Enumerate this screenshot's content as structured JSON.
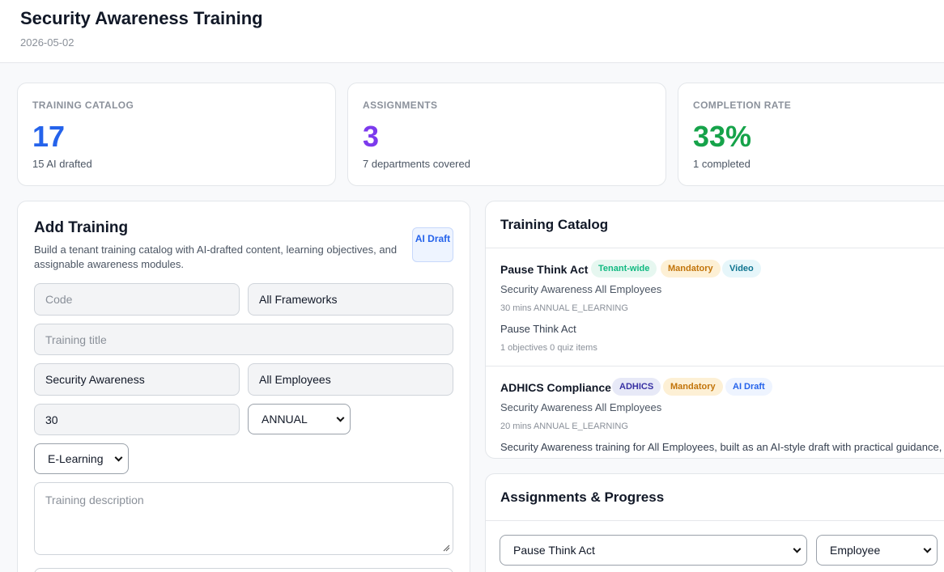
{
  "header": {
    "title": "Security Awareness Training",
    "date": "2026-05-02"
  },
  "stats": [
    {
      "label": "TRAINING CATALOG",
      "value": "17",
      "sub": "15 AI drafted",
      "color": "#2563eb"
    },
    {
      "label": "ASSIGNMENTS",
      "value": "3",
      "sub": "7 departments covered",
      "color": "#7c3aed"
    },
    {
      "label": "COMPLETION RATE",
      "value": "33%",
      "sub": "1 completed",
      "color": "#16a34a"
    }
  ],
  "add_training": {
    "title": "Add Training",
    "description": "Build a tenant training catalog with AI-drafted content, learning objectives, and assignable awareness modules.",
    "badge": "AI Draft",
    "code_placeholder": "Code",
    "framework": "All Frameworks",
    "title_placeholder": "Training title",
    "category": "Security Awareness",
    "audience": "All Employees",
    "duration": "30",
    "frequency": "ANNUAL",
    "delivery": "E-Learning",
    "description_placeholder": "Training description"
  },
  "catalog": {
    "title": "Training Catalog",
    "items": [
      {
        "name": "Pause Think Act",
        "tags": [
          "Tenant-wide",
          "Mandatory",
          "Video"
        ],
        "line1": "Security Awareness All Employees",
        "meta": "30 mins ANNUAL E_LEARNING",
        "text": "Pause Think Act",
        "counts": "1 objectives 0 quiz items"
      },
      {
        "name": "ADHICS Compliance",
        "tags": [
          "ADHICS",
          "Mandatory",
          "AI Draft"
        ],
        "line1": "Security Awareness All Employees",
        "meta": "20 mins ANNUAL E_LEARNING",
        "text": "Security Awareness training for All Employees, built as an AI-style draft with practical guidance, s"
      }
    ]
  },
  "assignments": {
    "title": "Assignments & Progress",
    "training_select": "Pause Think Act",
    "assignee_select": "Employee"
  },
  "colors": {
    "tenant_wide": "#10b981",
    "mandatory": "#d97706",
    "video": "#0891b2",
    "adhics": "#4338ca",
    "ai_draft": "#2563eb"
  }
}
